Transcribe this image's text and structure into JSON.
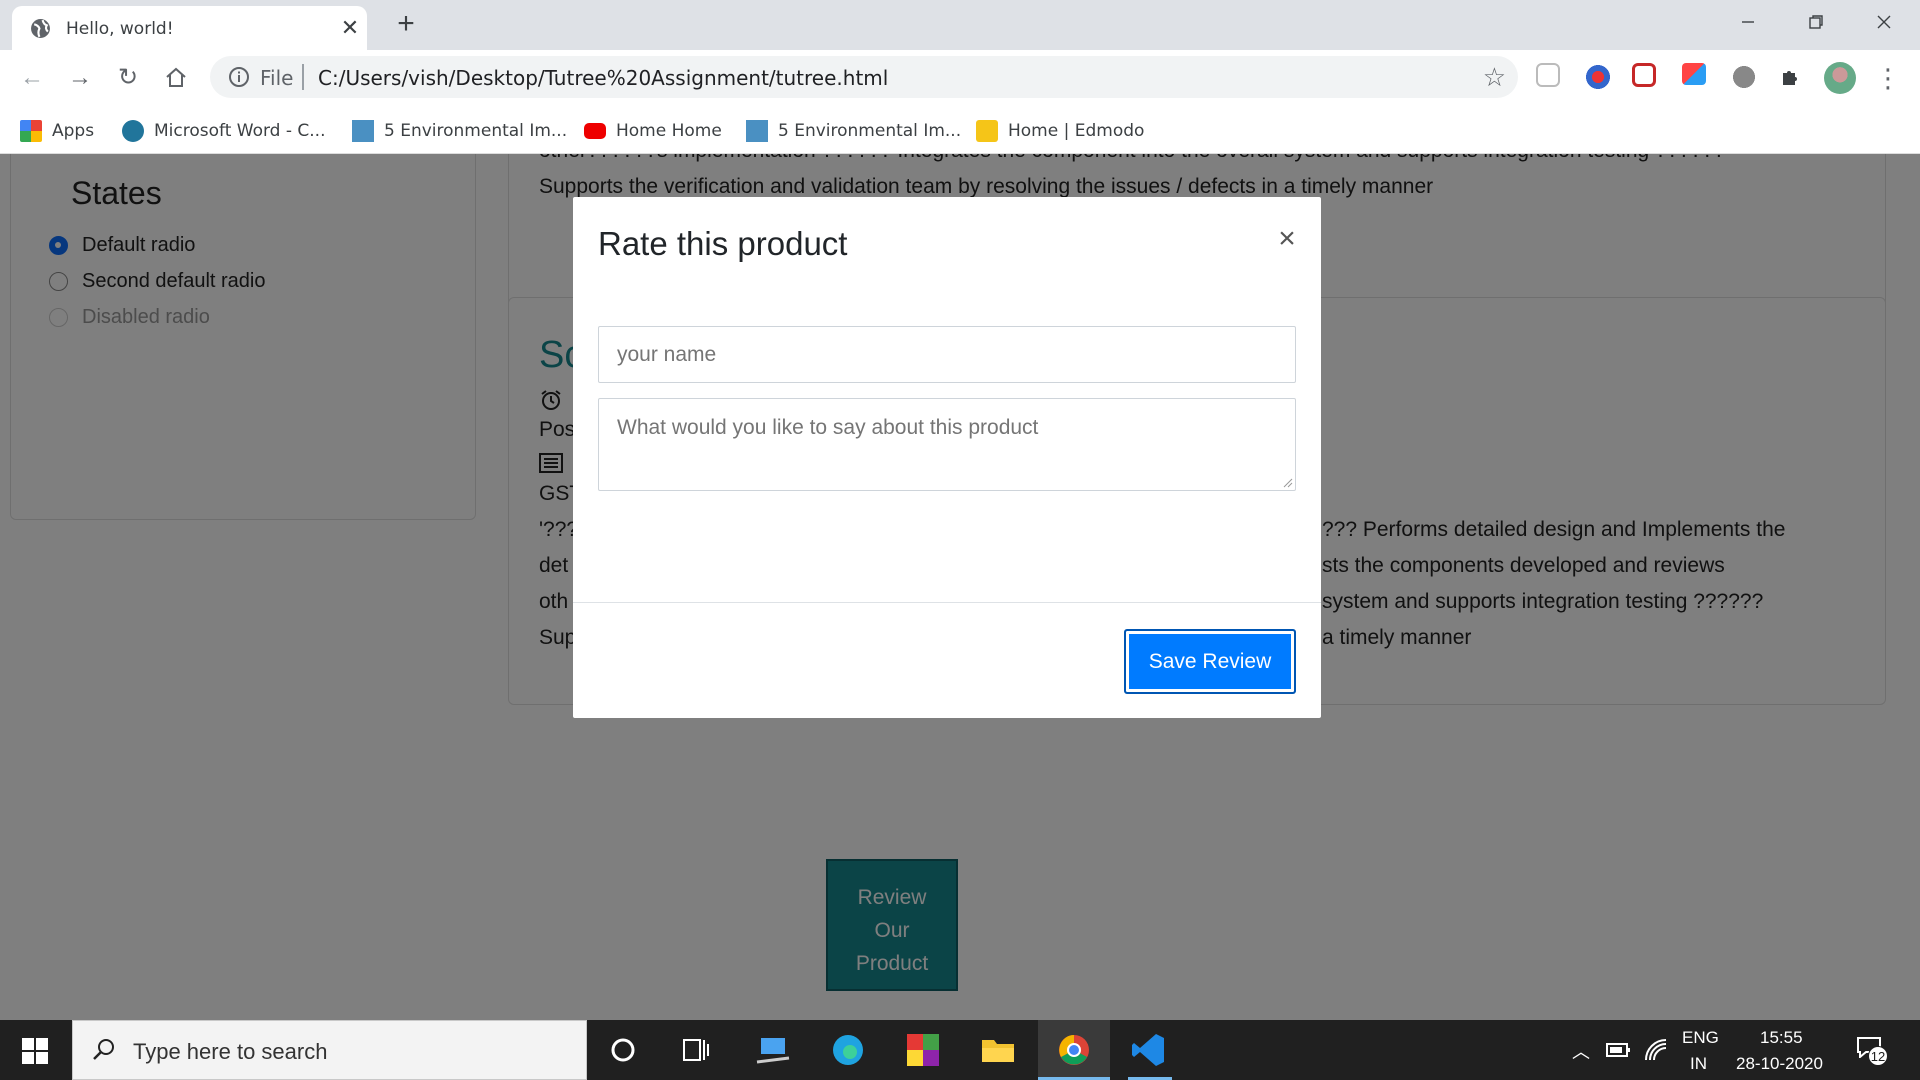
{
  "browser": {
    "tab_title": "Hello, world!",
    "address_scheme": "File",
    "url": "C:/Users/vish/Desktop/Tutree%20Assignment/tutree.html",
    "bookmarks": [
      {
        "label": "Apps",
        "icon": "apps-grid-icon"
      },
      {
        "label": "Microsoft Word - C...",
        "icon": "wordpress-icon"
      },
      {
        "label": "5 Environmental Im...",
        "icon": "na-icon"
      },
      {
        "label": "Home Home",
        "icon": "youtube-icon"
      },
      {
        "label": "5 Environmental Im...",
        "icon": "na-icon"
      },
      {
        "label": "Home | Edmodo",
        "icon": "edmodo-icon"
      }
    ]
  },
  "page": {
    "states_title": "States",
    "radios": [
      {
        "label": "Default radio",
        "checked": true
      },
      {
        "label": "Second default radio",
        "checked": false
      },
      {
        "label": "Disabled radio",
        "disabled": true
      }
    ],
    "top_card_lines": [
      "other??????s implementation ?????? Integrates the component into the overall system and supports integration testing ??????",
      "Supports the verification and validation team by resolving the issues / defects in a timely manner"
    ],
    "second_card": {
      "title_partial": "Sc",
      "line_pos": "Pos",
      "line_gst": "GST",
      "line_q": "'???",
      "line_det": "det",
      "line_oth": "oth",
      "line_sup": "Sup",
      "right_lines": [
        "??? Performs detailed design and Implements the",
        "sts the components developed and reviews",
        "system and supports integration testing ??????",
        "a timely manner"
      ]
    },
    "review_button": [
      "Review",
      "Our",
      "Product"
    ]
  },
  "modal": {
    "title": "Rate this product",
    "close_symbol": "×",
    "name_placeholder": "your name",
    "review_placeholder": "What would you like to say about this product",
    "save_label": "Save Review"
  },
  "taskbar": {
    "search_placeholder": "Type here to search",
    "lang_top": "ENG",
    "lang_bottom": "IN",
    "time": "15:55",
    "date": "28-10-2020",
    "notification_count": "12"
  }
}
